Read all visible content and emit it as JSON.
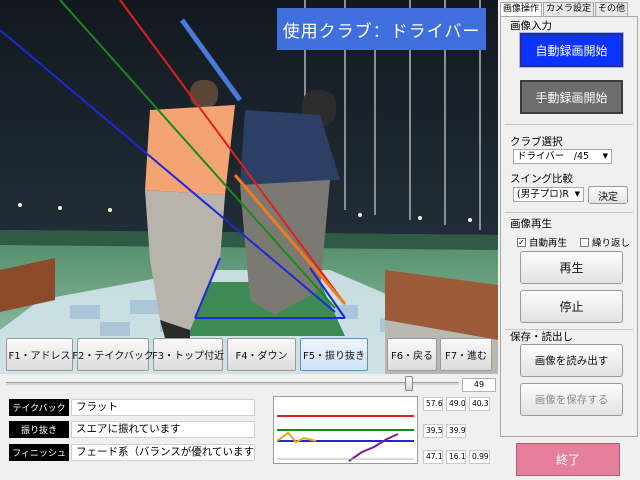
{
  "video": {
    "club_title": "使用クラブ：ドライバー"
  },
  "fkeys": [
    {
      "label": "F1・アドレス"
    },
    {
      "label": "F2・テイクバック"
    },
    {
      "label": "F3・トップ付近"
    },
    {
      "label": "F4・ダウン"
    },
    {
      "label": "F5・振り抜き"
    },
    {
      "label": "F6・戻る"
    },
    {
      "label": "F7・進む"
    }
  ],
  "slider": {
    "value": "49",
    "position": 0.9
  },
  "analysis": [
    {
      "label": "テイクバック",
      "value": "フラット"
    },
    {
      "label": "振り抜き",
      "value": "スエアに振れています"
    },
    {
      "label": "フィニッシュ",
      "value": "フェード系（バランスが優れています）"
    }
  ],
  "numbers": [
    "57.6",
    "49.0",
    "40.3",
    "39.5",
    "39.9",
    "47.1",
    "16.1",
    "0.99"
  ],
  "line_colors": {
    "red": "#e0201c",
    "green": "#1a8a1a",
    "blue": "#1a2ad8",
    "orange": "#f0a020",
    "purple": "#7a1a9a"
  },
  "tabs": [
    "画像操作",
    "カメラ設定",
    "その他"
  ],
  "panel": {
    "image_input": "画像入力",
    "auto_record": "自動録画開始",
    "manual_record": "手動録画開始",
    "club_select_label": "クラブ選択",
    "club_select_value": "ドライバー　/45",
    "swing_compare_label": "スイング比較",
    "swing_compare_value": "(男子プロ)R",
    "decide": "決定",
    "playback_label": "画像再生",
    "auto_play": "自動再生",
    "auto_play_checked": true,
    "repeat": "繰り返し",
    "repeat_checked": false,
    "play": "再生",
    "stop": "停止",
    "save_load_label": "保存・読出し",
    "load_image": "画像を読み出す",
    "save_image": "画像を保存する",
    "exit": "終了"
  },
  "icons": [
    "dropdown-arrow-icon",
    "checkbox-icon"
  ]
}
